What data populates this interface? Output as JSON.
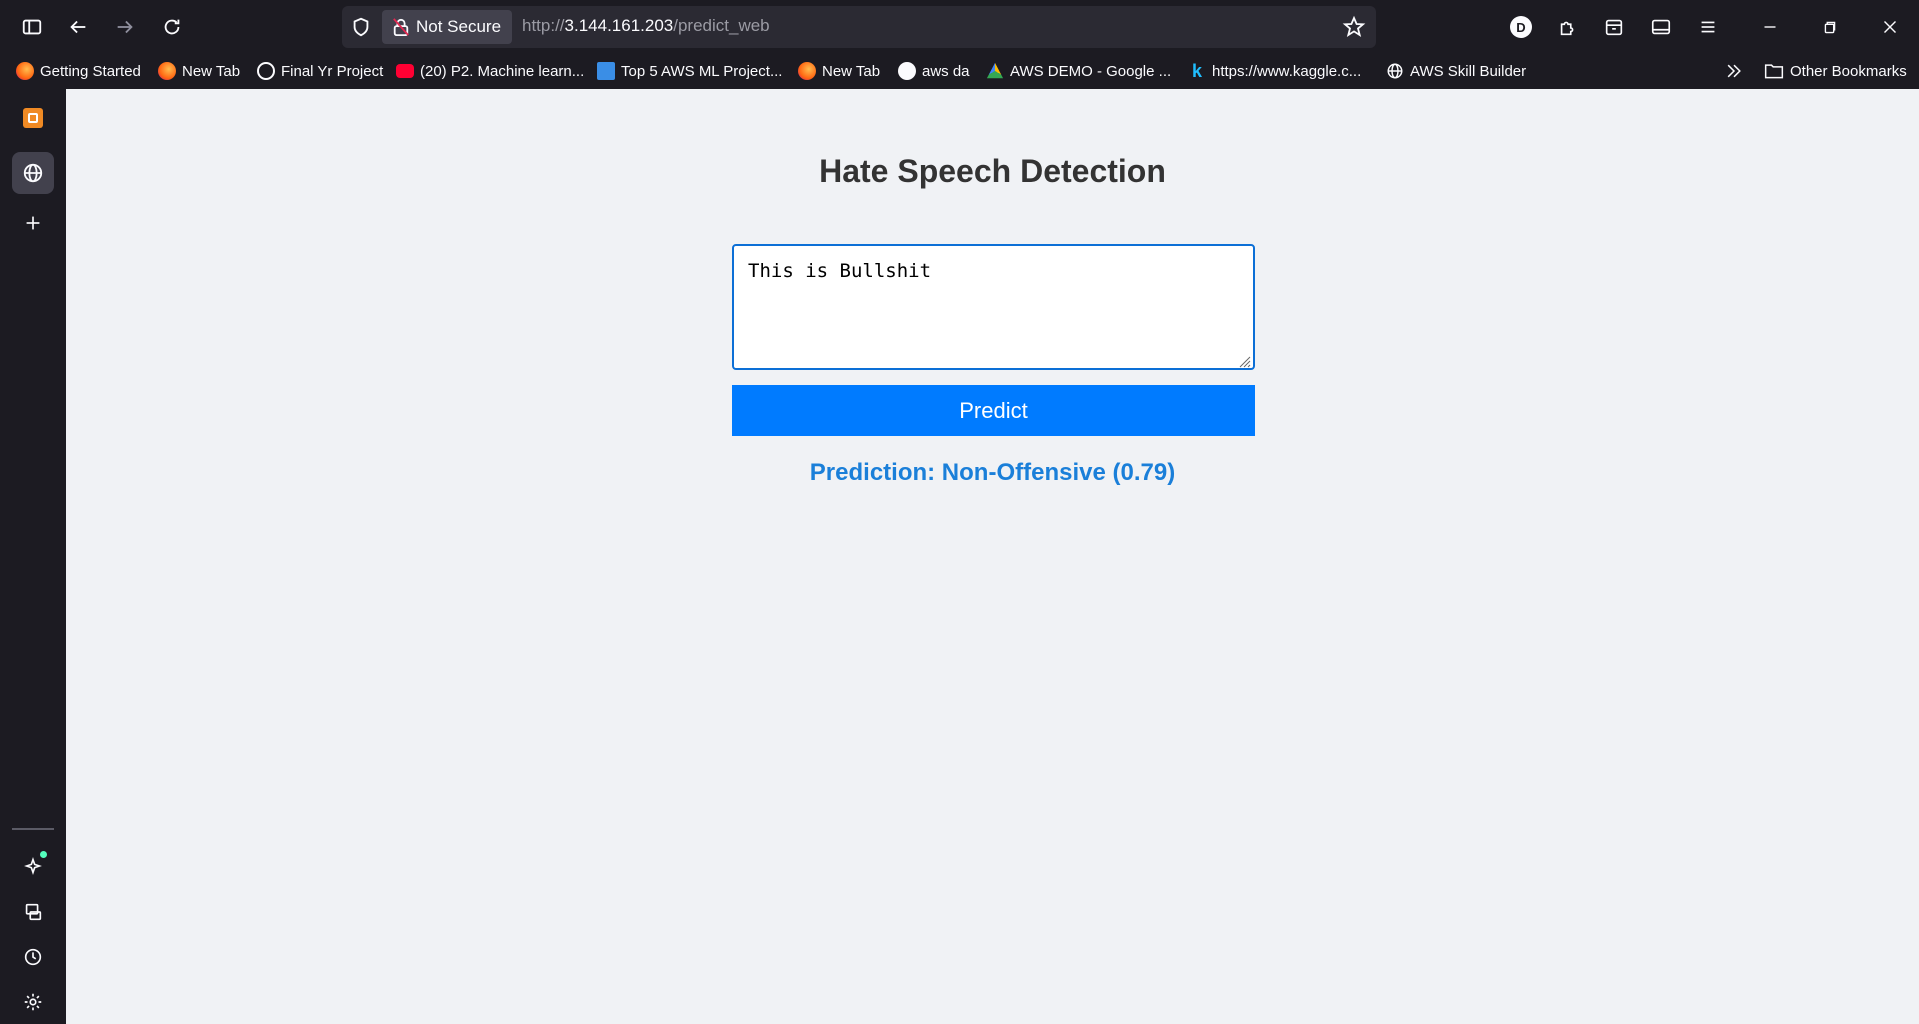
{
  "browser": {
    "security_label": "Not Secure",
    "url_scheme": "http://",
    "url_host": "3.144.161.203",
    "url_path": "/predict_web",
    "profile_initial": "D"
  },
  "bookmarks": {
    "items": [
      {
        "label": "Getting Started",
        "icon": "firefox-icon"
      },
      {
        "label": "New Tab",
        "icon": "firefox-icon"
      },
      {
        "label": "Final Yr Project",
        "icon": "openai-icon"
      },
      {
        "label": "(20) P2. Machine learn...",
        "icon": "youtube-icon"
      },
      {
        "label": "Top 5 AWS ML Project...",
        "icon": "pp-icon"
      },
      {
        "label": "New Tab",
        "icon": "firefox-icon"
      },
      {
        "label": "aws da",
        "icon": "dot-icon"
      },
      {
        "label": "AWS DEMO - Google ...",
        "icon": "google-drive-icon"
      },
      {
        "label": "https://www.kaggle.c...",
        "icon": "kaggle-icon"
      },
      {
        "label": "AWS Skill Builder",
        "icon": "globe-icon"
      }
    ],
    "other_label": "Other Bookmarks"
  },
  "page": {
    "title": "Hate Speech Detection",
    "input_text": "This is Bullshit",
    "predict_label": "Predict",
    "result": "Prediction: Non-Offensive (0.79)"
  },
  "colors": {
    "button": "#007bff",
    "result": "#1a7fd9",
    "background": "#f0f2f5",
    "chrome": "#1c1b22"
  }
}
